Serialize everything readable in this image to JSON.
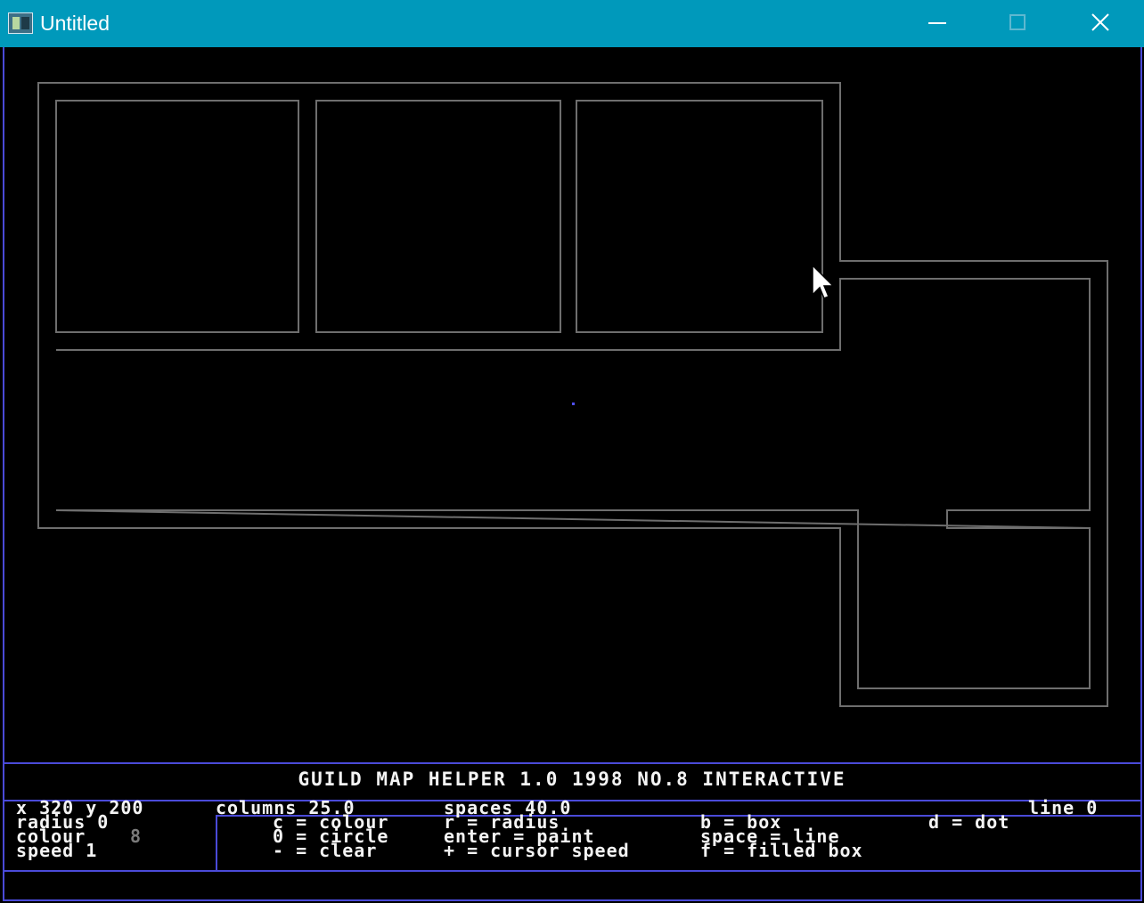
{
  "window": {
    "title": "Untitled",
    "icon": "app-window-icon",
    "controls": [
      "minimize-icon",
      "maximize-icon",
      "close-icon"
    ]
  },
  "app": {
    "heading": "GUILD MAP HELPER 1.0   1998 NO.8 INTERACTIVE"
  },
  "status": {
    "xy": "x 320 y 200",
    "radius": "radius 0",
    "colour_label": "colour",
    "colour_value": "8",
    "speed": "speed 1",
    "columns": "columns 25.0",
    "spaces": "spaces 40.0",
    "line": "line 0"
  },
  "help": {
    "c": "c = colour",
    "o": "0 = circle",
    "minus": "- = clear",
    "r": "r = radius",
    "enter": "enter = paint",
    "plus": "+ = cursor speed",
    "b": "b = box",
    "space": "space = line",
    "f": "f = filled box",
    "d": "d = dot"
  },
  "colors": {
    "titlebar": "#0099bb",
    "frame": "#4a4ad8",
    "lines": "#6e6e6e",
    "text": "#f4f4f4"
  }
}
